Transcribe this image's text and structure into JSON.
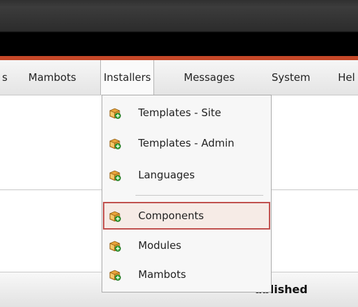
{
  "menubar": {
    "items": [
      {
        "label": "s"
      },
      {
        "label": "Mambots"
      },
      {
        "label": "Installers"
      },
      {
        "label": "Messages"
      },
      {
        "label": "System"
      },
      {
        "label": "Hel"
      }
    ]
  },
  "installers_menu": {
    "items": [
      {
        "label": "Templates - Site",
        "icon": "installer-box-icon"
      },
      {
        "label": "Templates - Admin",
        "icon": "installer-box-icon"
      },
      {
        "label": "Languages",
        "icon": "installer-box-icon"
      },
      {
        "label": "Components",
        "icon": "installer-box-icon"
      },
      {
        "label": "Modules",
        "icon": "installer-box-icon"
      },
      {
        "label": "Mambots",
        "icon": "installer-box-icon"
      }
    ],
    "highlighted": "Components"
  },
  "table_header": {
    "published_label": "ublished"
  },
  "colors": {
    "accent_red": "#c64828",
    "highlight_border": "#c0504d",
    "highlight_bg": "#f6ebe6"
  }
}
